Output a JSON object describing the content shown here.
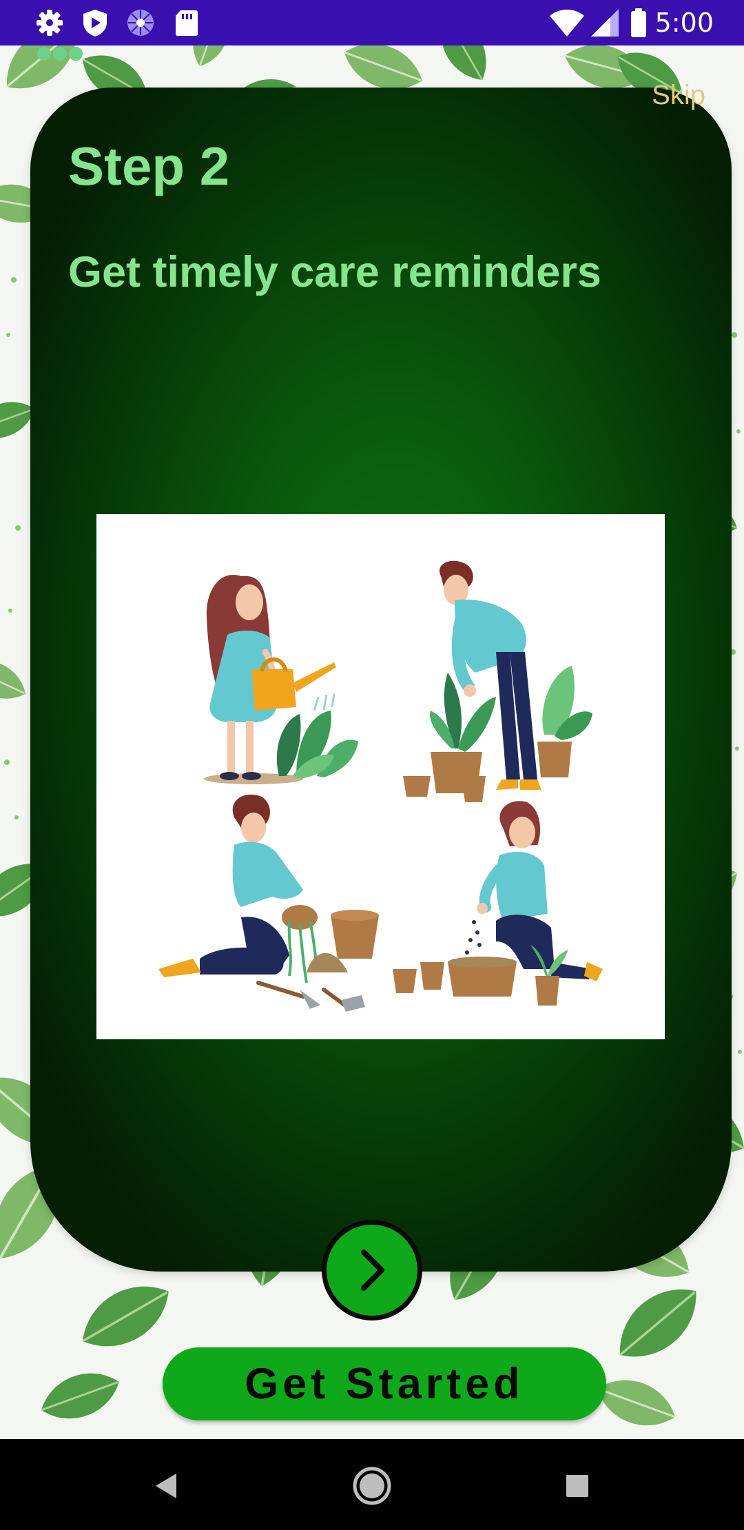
{
  "status_bar": {
    "time": "5:00",
    "left_icons": [
      "gear-icon",
      "play-shield-icon",
      "spinner-icon",
      "sd-card-icon"
    ],
    "right_icons": [
      "wifi-icon",
      "signal-icon",
      "battery-icon"
    ],
    "background_color": "#3a0fb0"
  },
  "onboarding": {
    "skip_label": "Skip",
    "step_title": "Step 2",
    "step_subtitle": "Get timely care reminders",
    "illustration_icon": "gardening-people-illustration",
    "page_indicator_count": 3,
    "next_icon": "chevron-right-icon",
    "get_started_label": "Get Started"
  },
  "colors": {
    "card_green": "#0a5a0c",
    "title_green": "#86e48e",
    "skip_color": "#e4c87a",
    "button_green": "#10a81b"
  },
  "nav_bar": {
    "icons": [
      "back-triangle-icon",
      "home-circle-icon",
      "recents-square-icon"
    ]
  }
}
